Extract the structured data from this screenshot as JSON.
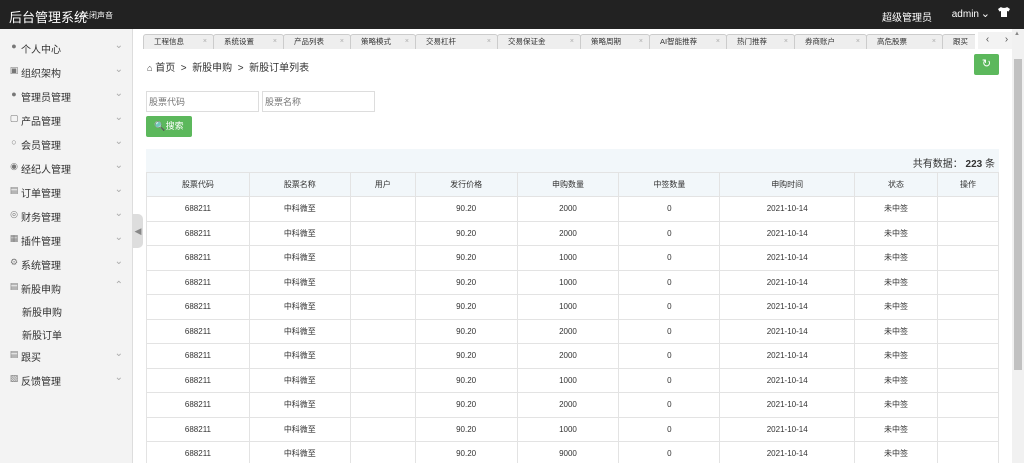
{
  "header": {
    "title": "后台管理系统",
    "mute_label": "关闭声音",
    "role_label": "超级管理员",
    "username": "admin"
  },
  "sidebar": {
    "items": [
      {
        "label": "个人中心",
        "icon": "user-icon"
      },
      {
        "label": "组织架构",
        "icon": "org-icon"
      },
      {
        "label": "管理员管理",
        "icon": "user-icon"
      },
      {
        "label": "产品管理",
        "icon": "box-icon"
      },
      {
        "label": "会员管理",
        "icon": "user-outline-icon"
      },
      {
        "label": "经纪人管理",
        "icon": "group-icon"
      },
      {
        "label": "订单管理",
        "icon": "doc-icon"
      },
      {
        "label": "财务管理",
        "icon": "coin-icon"
      },
      {
        "label": "插件管理",
        "icon": "puzzle-icon"
      },
      {
        "label": "系统管理",
        "icon": "gear-icon"
      },
      {
        "label": "新股申购",
        "icon": "doc-icon"
      },
      {
        "label": "跟买",
        "icon": "doc-icon"
      },
      {
        "label": "反馈管理",
        "icon": "feedback-icon"
      }
    ],
    "subitems": [
      "新股申购",
      "新股订单"
    ]
  },
  "tabs": [
    "工程信息",
    "系统设置",
    "产品列表",
    "策略模式",
    "交易杠杆",
    "交易保证金",
    "策略周期",
    "AI智能推荐",
    "热门推荐",
    "券商账户",
    "高危股票",
    "跟买"
  ],
  "breadcrumb": {
    "home": "首页",
    "sep": ">",
    "section": "新股申购",
    "current": "新股订单列表"
  },
  "search": {
    "code_placeholder": "股票代码",
    "name_placeholder": "股票名称",
    "button_label": "搜索"
  },
  "table": {
    "total_prefix": "共有数据：",
    "total_count": "223",
    "total_suffix": "条",
    "columns": [
      "股票代码",
      "股票名称",
      "用户",
      "发行价格",
      "申购数量",
      "中签数量",
      "申购时间",
      "状态",
      "操作"
    ],
    "rows": [
      [
        "688211",
        "中科微至",
        "",
        "90.20",
        "2000",
        "0",
        "2021-10-14",
        "未中签",
        ""
      ],
      [
        "688211",
        "中科微至",
        "",
        "90.20",
        "2000",
        "0",
        "2021-10-14",
        "未中签",
        ""
      ],
      [
        "688211",
        "中科微至",
        "",
        "90.20",
        "1000",
        "0",
        "2021-10-14",
        "未中签",
        ""
      ],
      [
        "688211",
        "中科微至",
        "",
        "90.20",
        "1000",
        "0",
        "2021-10-14",
        "未中签",
        ""
      ],
      [
        "688211",
        "中科微至",
        "",
        "90.20",
        "1000",
        "0",
        "2021-10-14",
        "未中签",
        ""
      ],
      [
        "688211",
        "中科微至",
        "",
        "90.20",
        "2000",
        "0",
        "2021-10-14",
        "未中签",
        ""
      ],
      [
        "688211",
        "中科微至",
        "",
        "90.20",
        "2000",
        "0",
        "2021-10-14",
        "未中签",
        ""
      ],
      [
        "688211",
        "中科微至",
        "",
        "90.20",
        "1000",
        "0",
        "2021-10-14",
        "未中签",
        ""
      ],
      [
        "688211",
        "中科微至",
        "",
        "90.20",
        "2000",
        "0",
        "2021-10-14",
        "未中签",
        ""
      ],
      [
        "688211",
        "中科微至",
        "",
        "90.20",
        "1000",
        "0",
        "2021-10-14",
        "未中签",
        ""
      ],
      [
        "688211",
        "中科微至",
        "",
        "90.20",
        "9000",
        "0",
        "2021-10-14",
        "未中签",
        ""
      ]
    ]
  },
  "colors": {
    "topbar": "#222222",
    "accent": "#5cb85c",
    "sidebar": "#f3f3f3"
  }
}
